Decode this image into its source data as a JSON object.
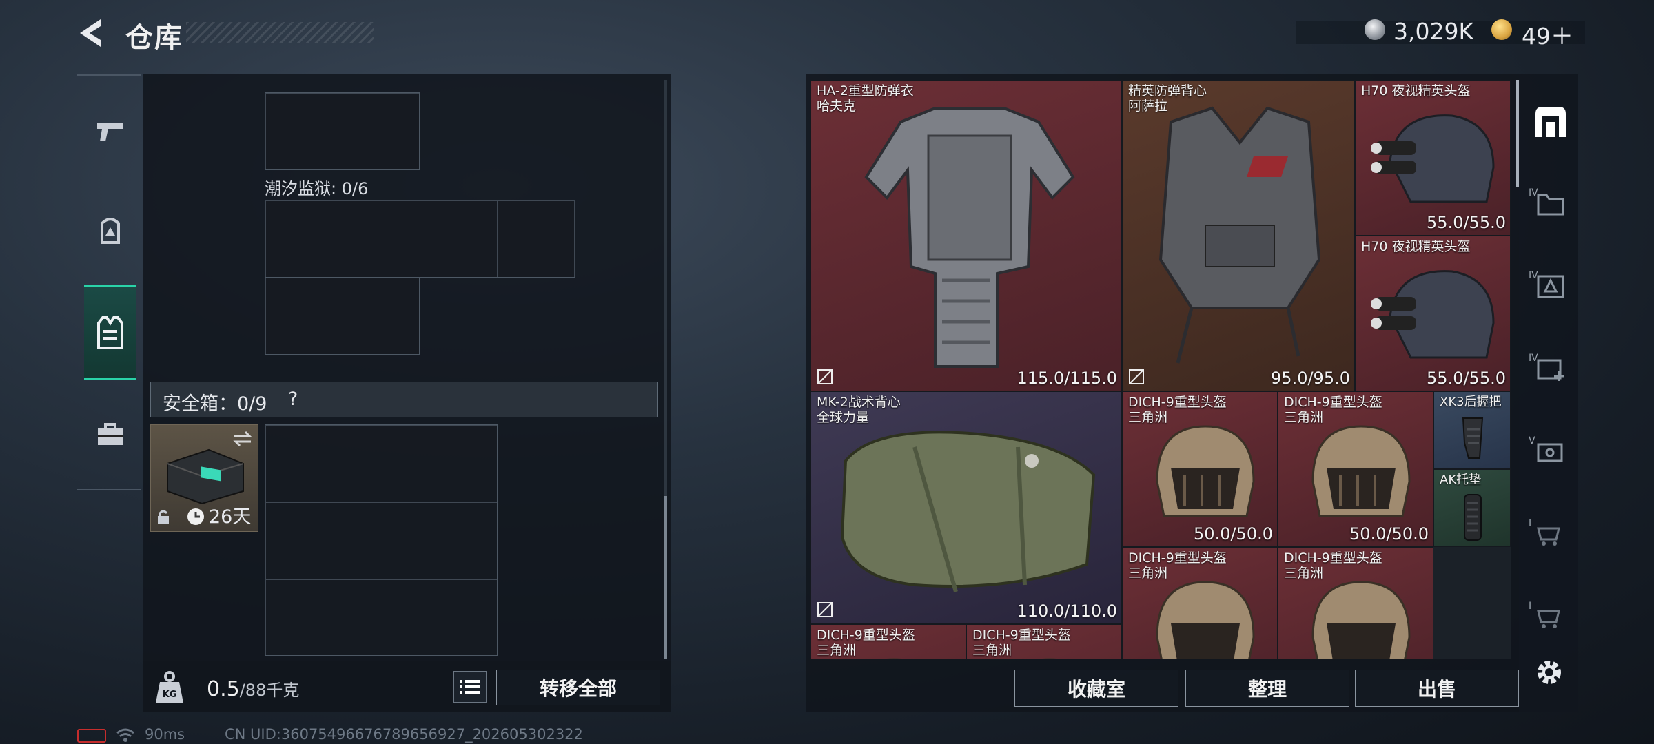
{
  "header": {
    "title": "仓库"
  },
  "currency": [
    {
      "value": "3,029K",
      "icon": "silver-coin-icon",
      "color": "#c8ccd2"
    },
    {
      "value": "49＋",
      "icon": "gold-coin-icon",
      "color": "#d9a441"
    }
  ],
  "left_nav": [
    {
      "icon": "gun-icon",
      "active": false
    },
    {
      "icon": "backpack-icon",
      "active": false
    },
    {
      "icon": "vest-icon",
      "active": true
    },
    {
      "icon": "toolbox-icon",
      "active": false
    }
  ],
  "storage": {
    "section_label": "潮汐监狱: 0/6",
    "safe_label": "安全箱：0/9",
    "safe_help": "?",
    "safebox_timer": "26天",
    "weight_value": "0.5",
    "weight_max": "/88千克",
    "transfer_all": "转移全部"
  },
  "items": [
    {
      "line1": "HA-2重型防弹衣",
      "line2": "哈夫克",
      "durability": "115.0/115.0",
      "rarity": "red",
      "icon": "heavy-armor-icon"
    },
    {
      "line1": "精英防弹背心",
      "line2": "阿萨拉",
      "durability": "95.0/95.0",
      "rarity": "brown",
      "icon": "elite-vest-icon"
    },
    {
      "line1": "H70 夜视精英头盔",
      "line2": "",
      "durability": "55.0/55.0",
      "rarity": "red",
      "icon": "nv-helmet-icon"
    },
    {
      "line1": "H70 夜视精英头盔",
      "line2": "",
      "durability": "55.0/55.0",
      "rarity": "red",
      "icon": "nv-helmet-icon"
    },
    {
      "line1": "MK-2战术背心",
      "line2": "全球力量",
      "durability": "110.0/110.0",
      "rarity": "purple",
      "icon": "tactical-vest-icon"
    },
    {
      "line1": "DICH-9重型头盔",
      "line2": "三角洲",
      "durability": "50.0/50.0",
      "rarity": "red",
      "icon": "heavy-helmet-icon"
    },
    {
      "line1": "DICH-9重型头盔",
      "line2": "三角洲",
      "durability": "50.0/50.0",
      "rarity": "red",
      "icon": "heavy-helmet-icon"
    },
    {
      "line1": "XK3后握把",
      "line2": "",
      "durability": "",
      "rarity": "blue",
      "icon": "grip-icon"
    },
    {
      "line1": "AK托垫",
      "line2": "",
      "durability": "",
      "rarity": "green",
      "icon": "buttpad-icon"
    },
    {
      "line1": "DICH-9重型头盔",
      "line2": "三角洲",
      "durability": "",
      "rarity": "red",
      "icon": "heavy-helmet-icon"
    },
    {
      "line1": "DICH-9重型头盔",
      "line2": "三角洲",
      "durability": "",
      "rarity": "red",
      "icon": "heavy-helmet-icon"
    },
    {
      "line1": "DICH-9重型头盔",
      "line2": "三角洲",
      "durability": "",
      "rarity": "red",
      "icon": "heavy-helmet-icon"
    },
    {
      "line1": "DICH-9重型头盔",
      "line2": "三角洲",
      "durability": "",
      "rarity": "red",
      "icon": "heavy-helmet-icon"
    }
  ],
  "right_tabs": [
    {
      "icon": "all-items-icon",
      "label": "",
      "active": true
    },
    {
      "icon": "category-folder-icon",
      "label": "IV"
    },
    {
      "icon": "category-supply-icon",
      "label": "IV"
    },
    {
      "icon": "category-medical-icon",
      "label": "IV"
    },
    {
      "icon": "category-case-icon",
      "label": "V"
    },
    {
      "icon": "category-cart-icon",
      "label": "I"
    },
    {
      "icon": "category-cart-icon",
      "label": "I"
    }
  ],
  "actions": {
    "collection": "收藏室",
    "sort": "整理",
    "sell": "出售"
  },
  "status": {
    "ping": "90ms",
    "uid": "CN UID:3607549667678965692​7_202605302322"
  }
}
